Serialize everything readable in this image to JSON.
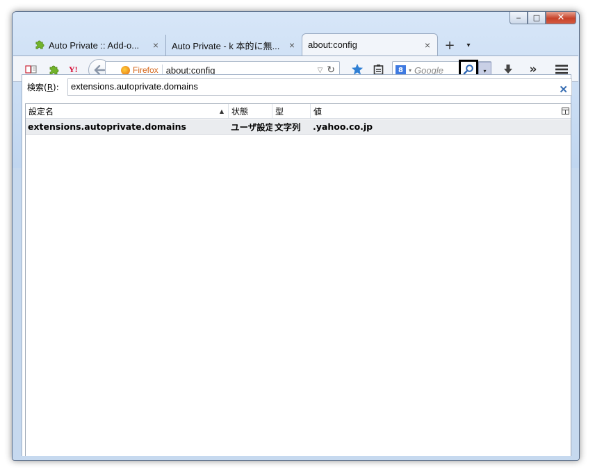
{
  "window": {
    "controls": {
      "minimize": "‒",
      "maximize": "□",
      "close": "✕"
    }
  },
  "tabs": [
    {
      "title": "Auto Private :: Add-o...",
      "icon": "puzzle-icon",
      "active": false
    },
    {
      "title": "Auto Private - k 本的に無...",
      "icon": "",
      "active": false
    },
    {
      "title": "about:config",
      "icon": "",
      "active": true
    }
  ],
  "tabstrip": {
    "new_tab": "+",
    "list_tabs": "▾",
    "close_glyph": "×"
  },
  "toolbar": {
    "url_identity": "Firefox",
    "url": "about:config",
    "search_placeholder": "Google",
    "search_engine_letter": "8",
    "overflow": "»",
    "menu": "≡"
  },
  "config": {
    "search_label": "検索(R):",
    "search_label_accesskey": "R",
    "filter_value": "extensions.autoprivate.domains",
    "columns": {
      "name": "設定名",
      "state": "状態",
      "type": "型",
      "value": "値"
    },
    "rows": [
      {
        "name": "extensions.autoprivate.domains",
        "state": "ユーザ設定",
        "type": "文字列",
        "value": ".yahoo.co.jp"
      }
    ]
  },
  "colors": {
    "frame": "#c6d9ef",
    "toolbar": "#f2f5fa",
    "close_button": "#c7432b",
    "bookmark_star": "#2f7fd4",
    "firefox_label": "#d5661a"
  }
}
